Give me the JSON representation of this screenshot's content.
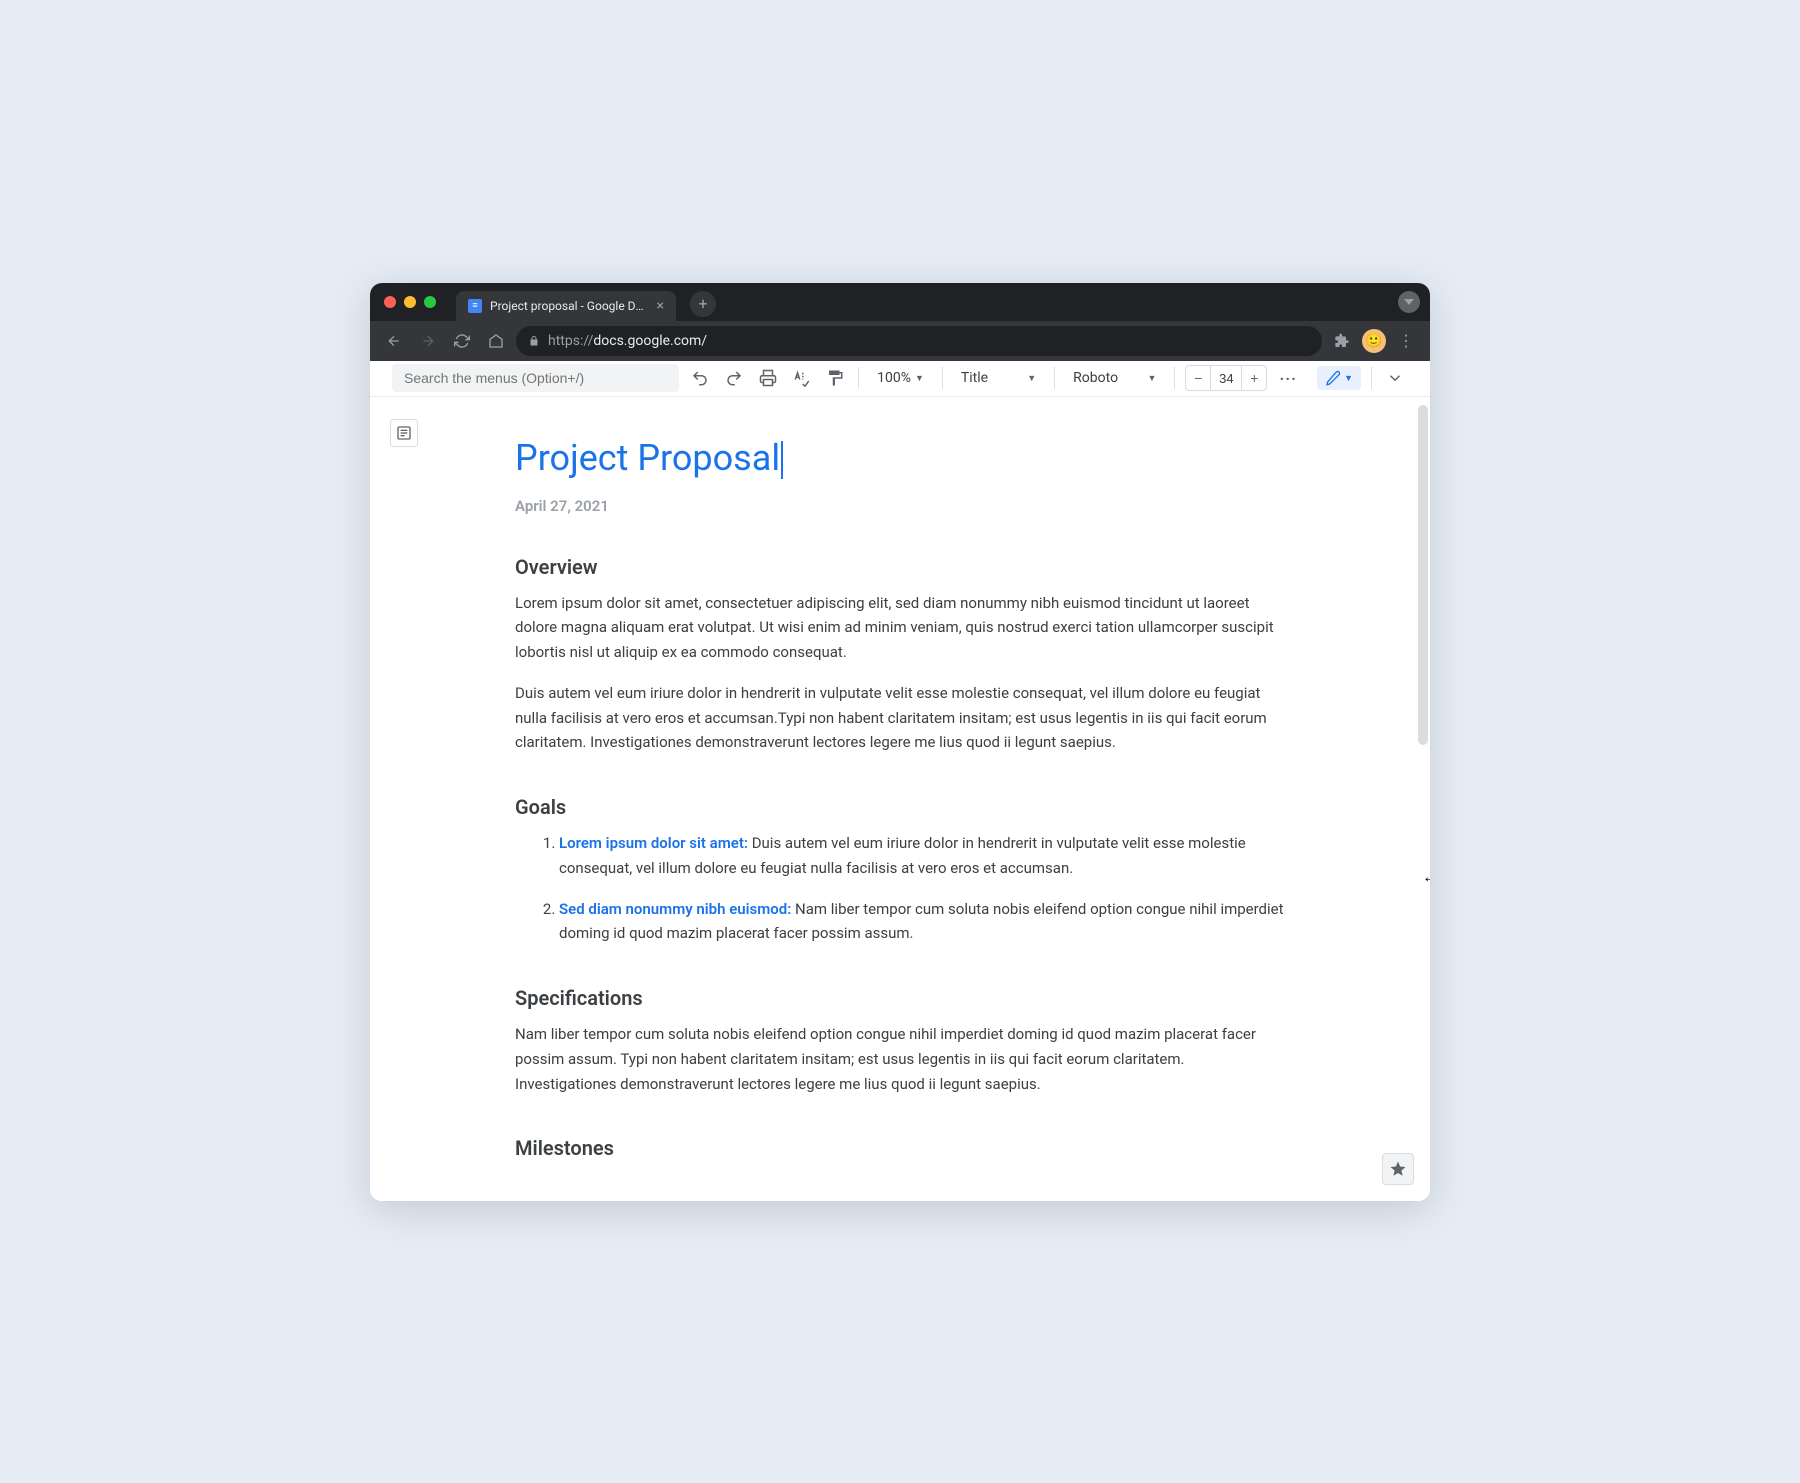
{
  "browser": {
    "tab_title": "Project proposal - Google Docs",
    "url_scheme": "https://",
    "url_rest": "docs.google.com/"
  },
  "toolbar": {
    "menu_search_placeholder": "Search the menus (Option+/)",
    "zoom": "100%",
    "style": "Title",
    "font": "Roboto",
    "font_size": "34"
  },
  "document": {
    "title": "Project Proposal",
    "date": "April 27, 2021",
    "sections": {
      "overview": {
        "heading": "Overview",
        "p1": "Lorem ipsum dolor sit amet, consectetuer adipiscing elit, sed diam nonummy nibh euismod tincidunt ut laoreet dolore magna aliquam erat volutpat. Ut wisi enim ad minim veniam, quis nostrud exerci tation ullamcorper suscipit lobortis nisl ut aliquip ex ea commodo consequat.",
        "p2": "Duis autem vel eum iriure dolor in hendrerit in vulputate velit esse molestie consequat, vel illum dolore eu feugiat nulla facilisis at vero eros et accumsan.Typi non habent claritatem insitam; est usus legentis in iis qui facit eorum claritatem. Investigationes demonstraverunt lectores legere me lius quod ii legunt saepius."
      },
      "goals": {
        "heading": "Goals",
        "items": [
          {
            "lead": "Lorem ipsum dolor sit amet:",
            "rest": " Duis autem vel eum iriure dolor in hendrerit in vulputate velit esse molestie consequat, vel illum dolore eu feugiat nulla facilisis at vero eros et accumsan."
          },
          {
            "lead": "Sed diam nonummy nibh euismod:",
            "rest": " Nam liber tempor cum soluta nobis eleifend option congue nihil imperdiet doming id quod mazim placerat facer possim assum."
          }
        ]
      },
      "specifications": {
        "heading": "Specifications",
        "p1": "Nam liber tempor cum soluta nobis eleifend option congue nihil imperdiet doming id quod mazim placerat facer possim assum. Typi non habent claritatem insitam; est usus legentis in iis qui facit eorum claritatem. Investigationes demonstraverunt lectores legere me lius quod ii legunt saepius."
      },
      "milestones": {
        "heading": "Milestones"
      }
    }
  }
}
